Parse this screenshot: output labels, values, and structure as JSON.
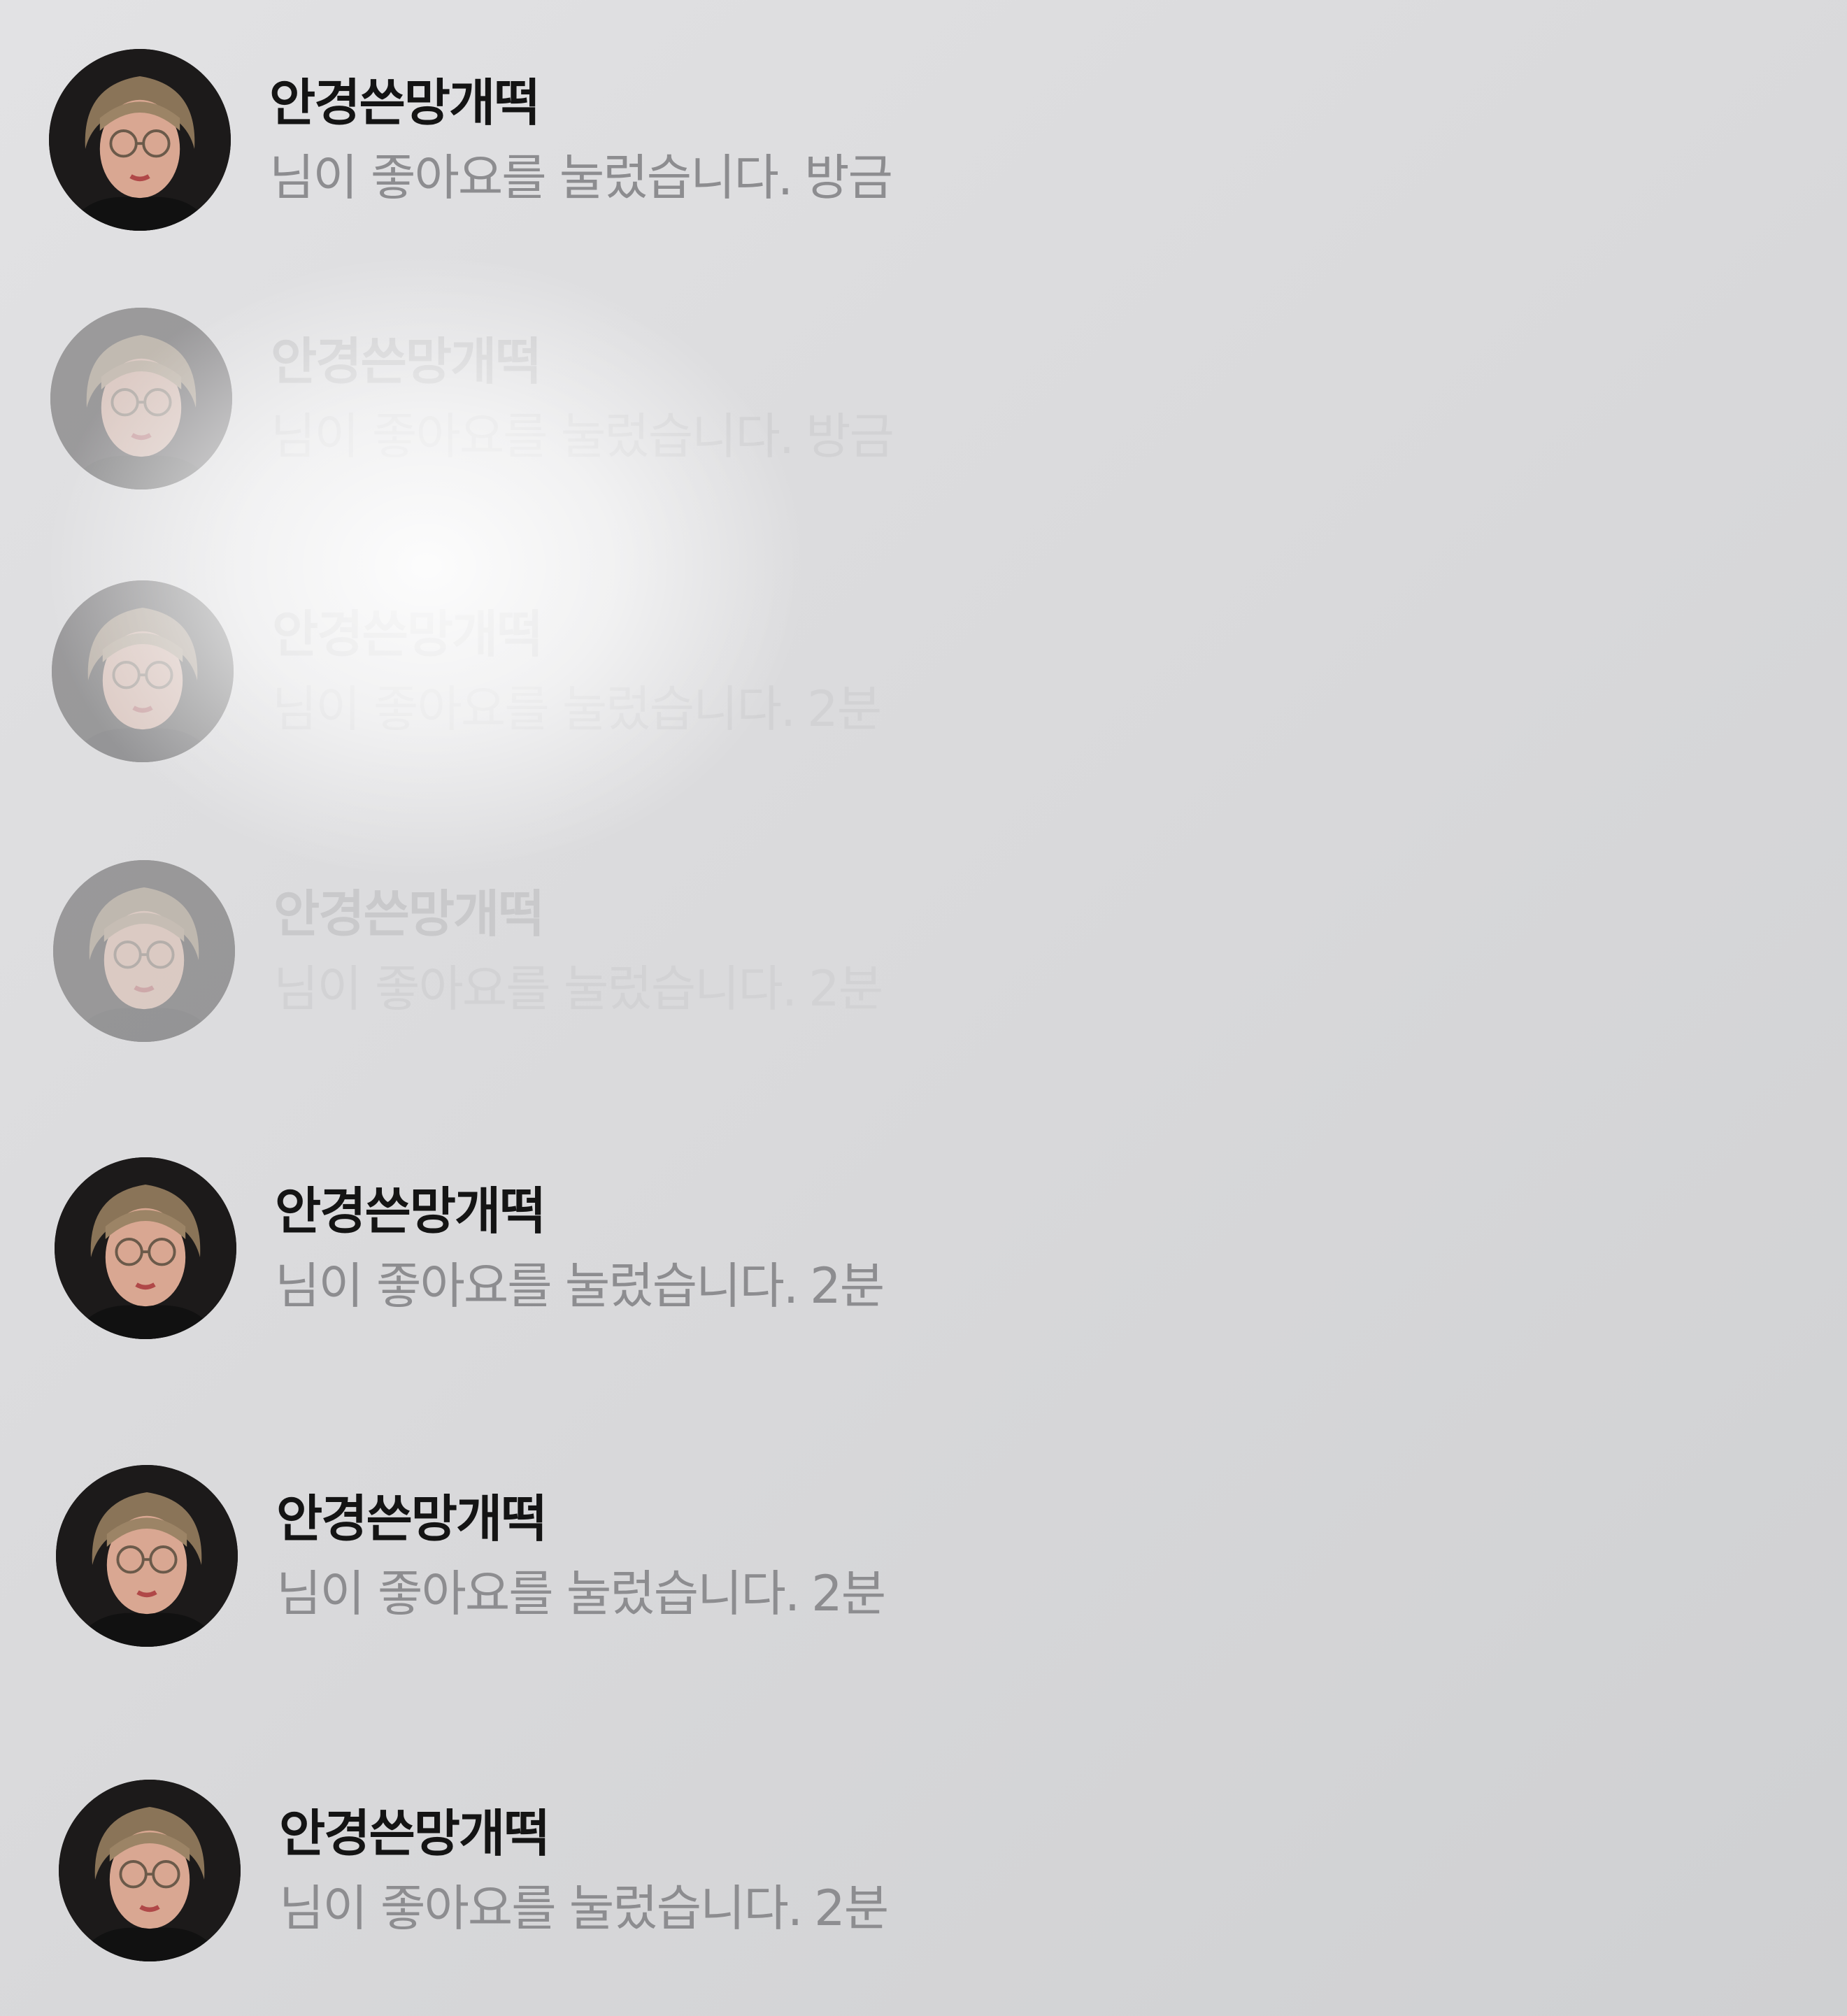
{
  "notifications": [
    {
      "username": "안경쓴망개떡",
      "message": "님이 좋아요를 눌렀습니다.",
      "time": "방금",
      "avatar_icon": "user-avatar-photo"
    },
    {
      "username": "안경쓴망개떡",
      "message": "님이 좋아요를 눌렀습니다.",
      "time": "방금",
      "avatar_icon": "user-avatar-photo"
    },
    {
      "username": "안경쓴망개떡",
      "message": "님이 좋아요를 눌렀습니다.",
      "time": "2분",
      "avatar_icon": "user-avatar-photo"
    },
    {
      "username": "안경쓴망개떡",
      "message": "님이 좋아요를 눌렀습니다.",
      "time": "2분",
      "avatar_icon": "user-avatar-photo"
    },
    {
      "username": "안경쓴망개떡",
      "message": "님이 좋아요를 눌렀습니다.",
      "time": "2분",
      "avatar_icon": "user-avatar-photo"
    },
    {
      "username": "안경쓴망개떡",
      "message": "님이 좋아요를 눌렀습니다.",
      "time": "2분",
      "avatar_icon": "user-avatar-photo"
    },
    {
      "username": "안경쓴망개떡",
      "message": "님이 좋아요를 눌렀습니다.",
      "time": "2분",
      "avatar_icon": "user-avatar-photo"
    }
  ],
  "colors": {
    "background": "#d9d9db",
    "username": "#141414",
    "message": "#8d8d90"
  }
}
